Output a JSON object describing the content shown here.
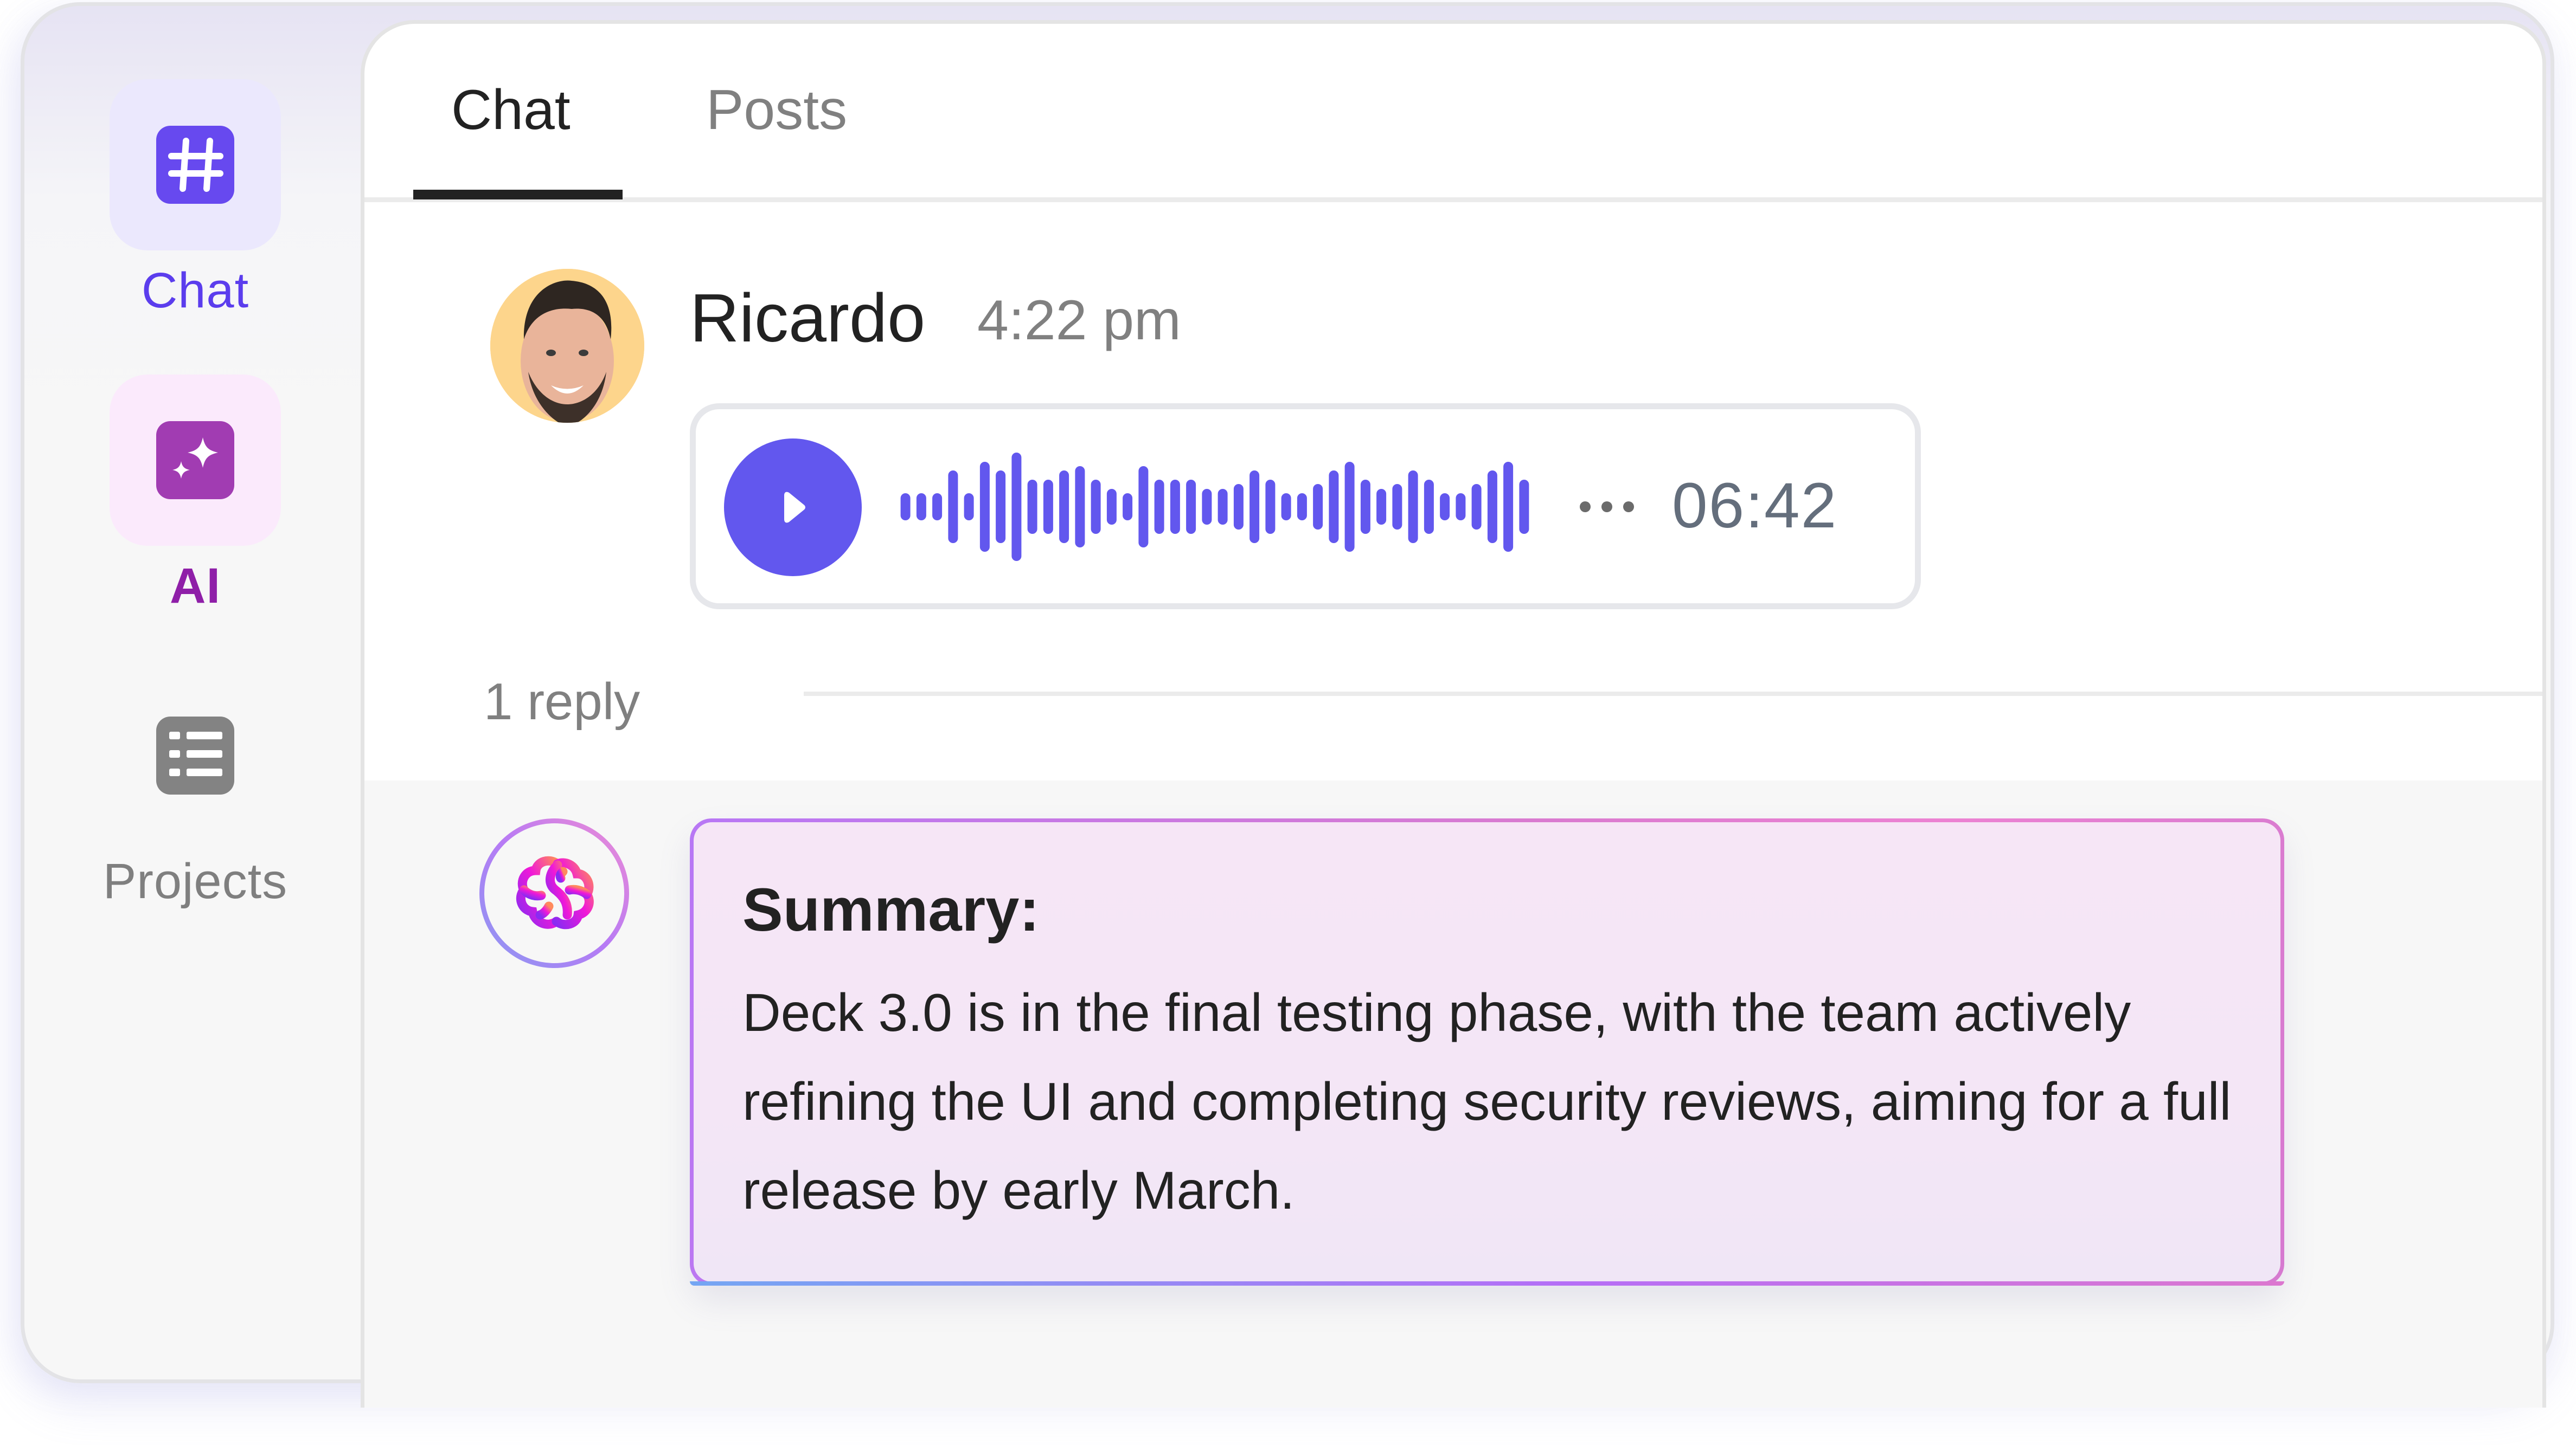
{
  "sidebar": {
    "items": [
      {
        "label": "Chat",
        "icon": "hash-icon",
        "active": true,
        "color": "#5b3ded"
      },
      {
        "label": "AI",
        "icon": "sparkles-icon",
        "active": false,
        "color": "#8f1fa8"
      },
      {
        "label": "Projects",
        "icon": "list-icon",
        "active": false,
        "color": "#7f7f7f"
      }
    ]
  },
  "tabs": [
    {
      "label": "Chat",
      "active": true
    },
    {
      "label": "Posts",
      "active": false
    }
  ],
  "message": {
    "author": "Ricardo",
    "time": "4:22 pm",
    "avatar": "user-avatar-photo",
    "audio": {
      "duration": "06:42",
      "accent": "#6257ee",
      "waveform": [
        0.25,
        0.25,
        0.25,
        0.67,
        0.25,
        0.83,
        0.67,
        1.0,
        0.5,
        0.5,
        0.67,
        0.75,
        0.5,
        0.33,
        0.25,
        0.75,
        0.5,
        0.5,
        0.5,
        0.33,
        0.33,
        0.42,
        0.67,
        0.5,
        0.25,
        0.25,
        0.42,
        0.67,
        0.83,
        0.5,
        0.33,
        0.42,
        0.67,
        0.5,
        0.25,
        0.25,
        0.42,
        0.67,
        0.83,
        0.5
      ]
    },
    "reply_count_label": "1 reply"
  },
  "summary": {
    "title": "Summary:",
    "body": "Deck 3.0 is in the final testing phase, with the team actively refining the UI and completing security reviews, aiming for a full release by early March."
  }
}
